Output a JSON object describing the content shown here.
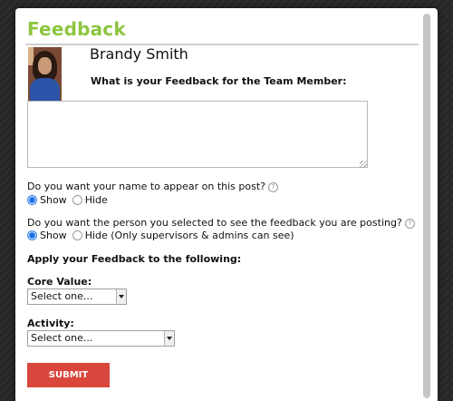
{
  "dialog": {
    "title": "Feedback",
    "member_name": "Brandy Smith",
    "feedback_question": "What is your Feedback for the Team Member:",
    "feedback_value": "",
    "name_question": "Do you want your name to appear on this post?",
    "name_options": {
      "show": "Show",
      "hide": "Hide",
      "selected": "show"
    },
    "visibility_question": "Do you want the person you selected to see the feedback you are posting?",
    "visibility_options": {
      "show": "Show",
      "hide": "Hide (Only supervisors & admins can see)",
      "selected": "show"
    },
    "apply_heading": "Apply your Feedback to the following:",
    "core_value": {
      "label": "Core Value:",
      "selected": "Select one..."
    },
    "activity": {
      "label": "Activity:",
      "selected": "Select one..."
    },
    "submit_label": "SUBMIT",
    "help_glyph": "?",
    "colors": {
      "title": "#8dc63f",
      "submit": "#d9473c",
      "radio_selected": "#1f6fe0"
    }
  }
}
